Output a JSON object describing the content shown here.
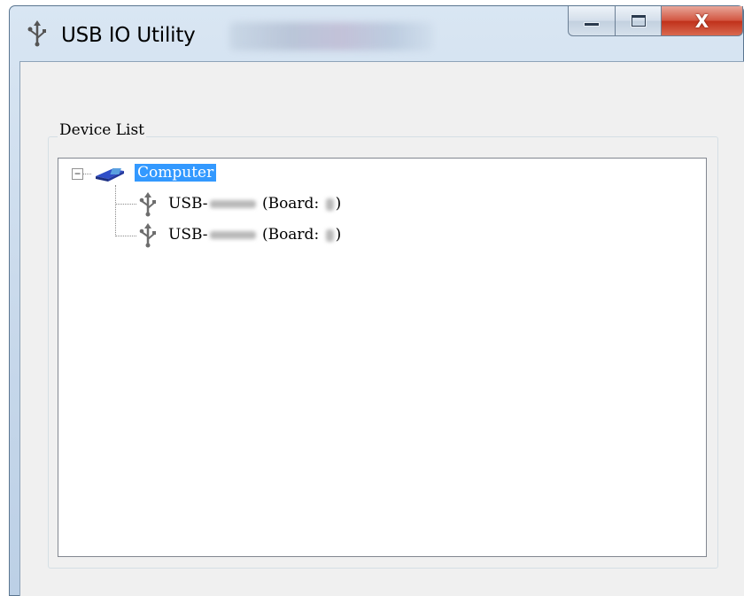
{
  "window": {
    "title": "USB IO Utility",
    "close_glyph": "X"
  },
  "group": {
    "label": "Device List"
  },
  "tree": {
    "root": {
      "label": "Computer",
      "expander": "−",
      "icon": "computer-icon",
      "selected": true
    },
    "devices": [
      {
        "prefix": "USB-",
        "board_prefix": "(Board: ",
        "board_suffix": ")",
        "icon": "usb-icon"
      },
      {
        "prefix": "USB-",
        "board_prefix": "(Board: ",
        "board_suffix": ")",
        "icon": "usb-icon"
      }
    ]
  },
  "colors": {
    "selection": "#3399ff",
    "close_button": "#c0301a",
    "tree_border": "#828790"
  }
}
